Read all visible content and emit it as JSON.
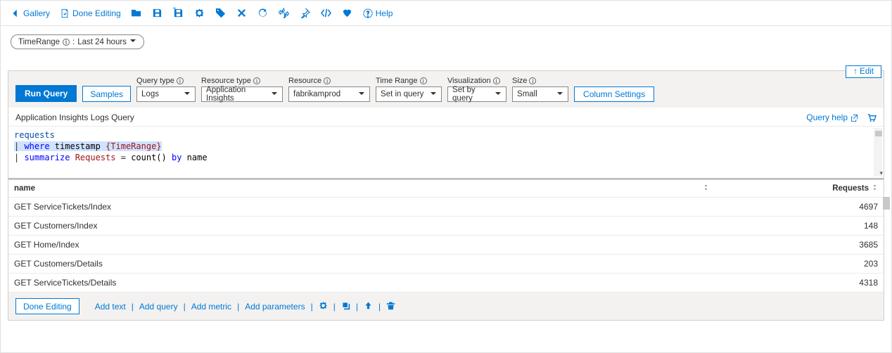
{
  "topbar": {
    "gallery": "Gallery",
    "done_editing": "Done Editing",
    "help": "Help"
  },
  "time_pill": {
    "name": "TimeRange",
    "label_sep": " : ",
    "value": "Last 24 hours"
  },
  "edit_top": "↑ Edit",
  "query_toolbar": {
    "run": "Run Query",
    "samples": "Samples",
    "query_type": {
      "label": "Query type",
      "value": "Logs"
    },
    "resource_type": {
      "label": "Resource type",
      "value": "Application Insights"
    },
    "resource": {
      "label": "Resource",
      "value": "fabrikamprod"
    },
    "time_range": {
      "label": "Time Range",
      "value": "Set in query"
    },
    "visualization": {
      "label": "Visualization",
      "value": "Set by query"
    },
    "size": {
      "label": "Size",
      "value": "Small"
    },
    "column_settings": "Column Settings"
  },
  "subtitle": {
    "text": "Application Insights Logs Query",
    "query_help": "Query help"
  },
  "code": {
    "l1_table": "requests",
    "l2_pipe": "| ",
    "l2_where": "where",
    "l2_field": " timestamp ",
    "l2_param": "{TimeRange}",
    "l3_pipe": "| ",
    "l3_summarize": "summarize",
    "l3_metric": " Requests ",
    "l3_eq": "= ",
    "l3_func": "count()",
    "l3_by": " by ",
    "l3_name": "name"
  },
  "table": {
    "cols": {
      "name": "name",
      "requests": "Requests"
    },
    "rows": [
      {
        "name": "GET ServiceTickets/Index",
        "req": "4697"
      },
      {
        "name": "GET Customers/Index",
        "req": "148"
      },
      {
        "name": "GET Home/Index",
        "req": "3685"
      },
      {
        "name": "GET Customers/Details",
        "req": "203"
      },
      {
        "name": "GET ServiceTickets/Details",
        "req": "4318"
      }
    ]
  },
  "bottom": {
    "done": "Done Editing",
    "add_text": "Add text",
    "add_query": "Add query",
    "add_metric": "Add metric",
    "add_params": "Add parameters"
  }
}
